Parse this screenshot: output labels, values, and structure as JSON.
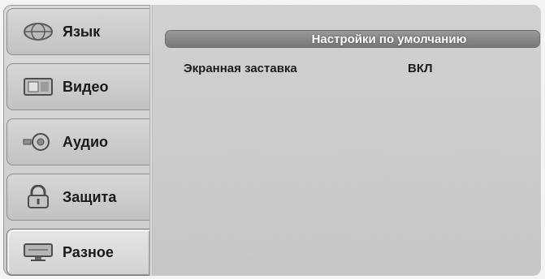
{
  "sidebar": {
    "items": [
      {
        "label": "Язык",
        "icon": "language-globe-icon"
      },
      {
        "label": "Видео",
        "icon": "video-screen-icon"
      },
      {
        "label": "Аудио",
        "icon": "audio-speaker-icon"
      },
      {
        "label": "Защита",
        "icon": "lock-icon"
      },
      {
        "label": "Разное",
        "icon": "misc-display-icon"
      }
    ],
    "active_index": 4
  },
  "main": {
    "header_title": "Настройки по умолчанию",
    "settings": [
      {
        "name": "Экранная заставка",
        "value": "ВКЛ"
      }
    ]
  }
}
